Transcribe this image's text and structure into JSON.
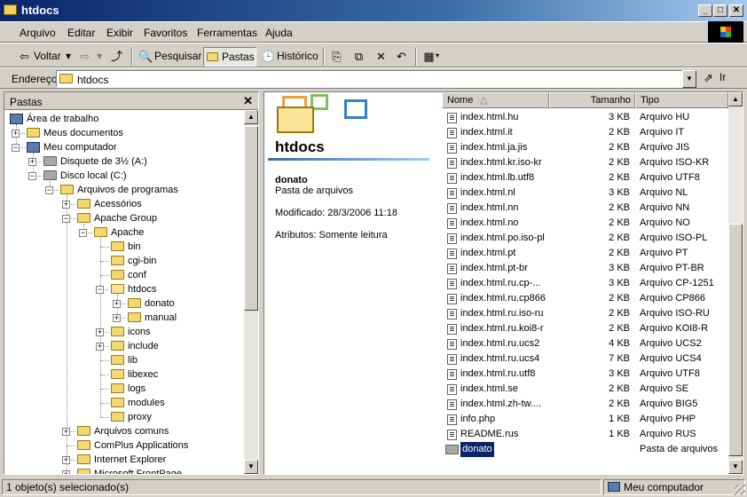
{
  "window": {
    "title": "htdocs"
  },
  "menu": [
    "Arquivo",
    "Editar",
    "Exibir",
    "Favoritos",
    "Ferramentas",
    "Ajuda"
  ],
  "toolbar": {
    "back": "Voltar",
    "search": "Pesquisar",
    "folders": "Pastas",
    "history": "Histórico"
  },
  "address": {
    "label": "Endereço",
    "value": "htdocs",
    "go": "Ir"
  },
  "folders_pane": {
    "header": "Pastas",
    "tree": [
      {
        "label": "Área de trabalho",
        "level": 0,
        "expander": "minus",
        "icon": "desktop-icon"
      },
      {
        "label": "Meus documentos",
        "level": 1,
        "expander": "plus",
        "icon": "my-documents-icon"
      },
      {
        "label": "Meu computador",
        "level": 1,
        "expander": "minus",
        "icon": "my-computer-icon"
      },
      {
        "label": "Disquete de 3½ (A:)",
        "level": 2,
        "expander": "plus",
        "icon": "floppy-drive-icon"
      },
      {
        "label": "Disco local (C:)",
        "level": 2,
        "expander": "minus",
        "icon": "hard-drive-icon"
      },
      {
        "label": "Arquivos de programas",
        "level": 3,
        "expander": "minus",
        "icon": "folder-icon"
      },
      {
        "label": "Acessórios",
        "level": 4,
        "expander": "plus",
        "icon": "folder-icon"
      },
      {
        "label": "Apache Group",
        "level": 4,
        "expander": "minus",
        "icon": "folder-icon"
      },
      {
        "label": "Apache",
        "level": 5,
        "expander": "minus",
        "icon": "folder-icon"
      },
      {
        "label": "bin",
        "level": 6,
        "expander": "",
        "icon": "folder-icon"
      },
      {
        "label": "cgi-bin",
        "level": 6,
        "expander": "",
        "icon": "folder-icon"
      },
      {
        "label": "conf",
        "level": 6,
        "expander": "",
        "icon": "folder-icon"
      },
      {
        "label": "htdocs",
        "level": 6,
        "expander": "minus",
        "icon": "open-folder-icon"
      },
      {
        "label": "donato",
        "level": 7,
        "expander": "plus",
        "icon": "folder-icon"
      },
      {
        "label": "manual",
        "level": 7,
        "expander": "plus",
        "icon": "folder-icon"
      },
      {
        "label": "icons",
        "level": 6,
        "expander": "plus",
        "icon": "folder-icon"
      },
      {
        "label": "include",
        "level": 6,
        "expander": "plus",
        "icon": "folder-icon"
      },
      {
        "label": "lib",
        "level": 6,
        "expander": "",
        "icon": "folder-icon"
      },
      {
        "label": "libexec",
        "level": 6,
        "expander": "",
        "icon": "folder-icon"
      },
      {
        "label": "logs",
        "level": 6,
        "expander": "",
        "icon": "folder-icon"
      },
      {
        "label": "modules",
        "level": 6,
        "expander": "",
        "icon": "folder-icon"
      },
      {
        "label": "proxy",
        "level": 6,
        "expander": "",
        "icon": "folder-icon"
      },
      {
        "label": "Arquivos comuns",
        "level": 4,
        "expander": "plus",
        "icon": "folder-icon"
      },
      {
        "label": "ComPlus Applications",
        "level": 4,
        "expander": "",
        "icon": "folder-icon"
      },
      {
        "label": "Internet Explorer",
        "level": 4,
        "expander": "plus",
        "icon": "folder-icon"
      },
      {
        "label": "Microsoft FrontPage",
        "level": 4,
        "expander": "plus",
        "icon": "folder-icon"
      }
    ]
  },
  "webview": {
    "title": "htdocs",
    "selected_name": "donato",
    "selected_type": "Pasta de arquivos",
    "modified": "Modificado: 28/3/2006 11:18",
    "attributes": "Atributos: Somente leitura"
  },
  "file_list": {
    "columns": {
      "name": "Nome",
      "size": "Tamanho",
      "type": "Tipo"
    },
    "rows": [
      {
        "name": "index.html.hu",
        "size": "3 KB",
        "type": "Arquivo HU"
      },
      {
        "name": "index.html.it",
        "size": "2 KB",
        "type": "Arquivo IT"
      },
      {
        "name": "index.html.ja.jis",
        "size": "2 KB",
        "type": "Arquivo JIS"
      },
      {
        "name": "index.html.kr.iso-kr",
        "size": "2 KB",
        "type": "Arquivo ISO-KR"
      },
      {
        "name": "index.html.lb.utf8",
        "size": "2 KB",
        "type": "Arquivo UTF8"
      },
      {
        "name": "index.html.nl",
        "size": "3 KB",
        "type": "Arquivo NL"
      },
      {
        "name": "index.html.nn",
        "size": "2 KB",
        "type": "Arquivo NN"
      },
      {
        "name": "index.html.no",
        "size": "2 KB",
        "type": "Arquivo NO"
      },
      {
        "name": "index.html.po.iso-pl",
        "size": "2 KB",
        "type": "Arquivo ISO-PL"
      },
      {
        "name": "index.html.pt",
        "size": "2 KB",
        "type": "Arquivo PT"
      },
      {
        "name": "index.html.pt-br",
        "size": "3 KB",
        "type": "Arquivo PT-BR"
      },
      {
        "name": "index.html.ru.cp-...",
        "size": "3 KB",
        "type": "Arquivo CP-1251"
      },
      {
        "name": "index.html.ru.cp866",
        "size": "2 KB",
        "type": "Arquivo CP866"
      },
      {
        "name": "index.html.ru.iso-ru",
        "size": "2 KB",
        "type": "Arquivo ISO-RU"
      },
      {
        "name": "index.html.ru.koi8-r",
        "size": "2 KB",
        "type": "Arquivo KOI8-R"
      },
      {
        "name": "index.html.ru.ucs2",
        "size": "4 KB",
        "type": "Arquivo UCS2"
      },
      {
        "name": "index.html.ru.ucs4",
        "size": "7 KB",
        "type": "Arquivo UCS4"
      },
      {
        "name": "index.html.ru.utf8",
        "size": "3 KB",
        "type": "Arquivo UTF8"
      },
      {
        "name": "index.html.se",
        "size": "2 KB",
        "type": "Arquivo SE"
      },
      {
        "name": "index.html.zh-tw....",
        "size": "2 KB",
        "type": "Arquivo BIG5"
      },
      {
        "name": "info.php",
        "size": "1 KB",
        "type": "Arquivo PHP"
      },
      {
        "name": "README.rus",
        "size": "1 KB",
        "type": "Arquivo RUS"
      },
      {
        "name": "donato",
        "size": "",
        "type": "Pasta de arquivos",
        "selected": true,
        "folder": true
      }
    ]
  },
  "status": {
    "left": "1 objeto(s) selecionado(s)",
    "zone": "Meu computador"
  },
  "colors": {
    "title_start": "#0a246a",
    "title_end": "#a6caf0",
    "face": "#d4d0c8",
    "selection": "#0a246a"
  }
}
